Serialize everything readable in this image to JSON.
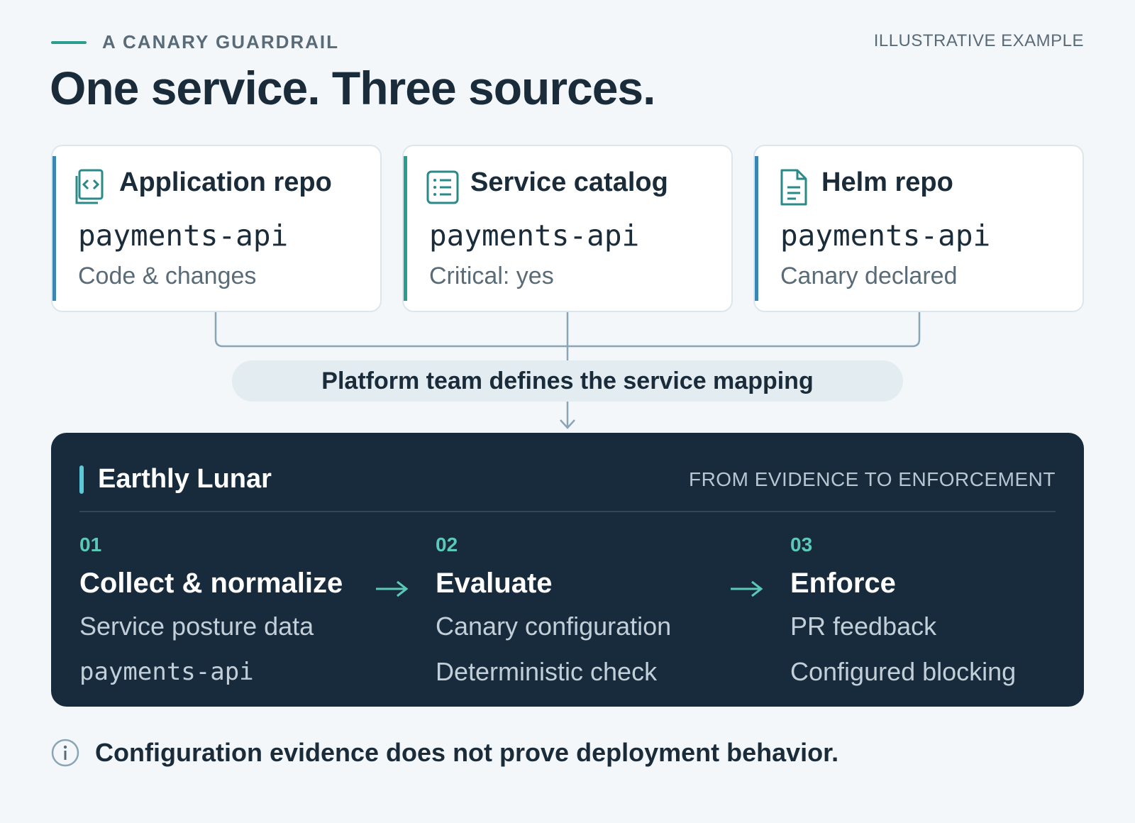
{
  "header": {
    "eyebrow": "A CANARY GUARDRAIL",
    "tag": "ILLUSTRATIVE EXAMPLE",
    "title": "One service. Three sources."
  },
  "sources": [
    {
      "title": "Application repo",
      "service": "payments-api",
      "detail": "Code & changes",
      "icon": "code-files-icon",
      "accent": "#3a87b5"
    },
    {
      "title": "Service catalog",
      "service": "payments-api",
      "detail": "Critical: yes",
      "icon": "list-icon",
      "accent": "#2a9d8f"
    },
    {
      "title": "Helm repo",
      "service": "payments-api",
      "detail": "Canary declared",
      "icon": "document-icon",
      "accent": "#3a87b5"
    }
  ],
  "mapping": {
    "label": "Platform team defines the service mapping"
  },
  "panel": {
    "title": "Earthly Lunar",
    "tag": "FROM EVIDENCE TO ENFORCEMENT",
    "steps": [
      {
        "number": "01",
        "title": "Collect & normalize",
        "line1": "Service posture data",
        "line2": "payments-api"
      },
      {
        "number": "02",
        "title": "Evaluate",
        "line1": "Canary configuration",
        "line2": "Deterministic check"
      },
      {
        "number": "03",
        "title": "Enforce",
        "line1": "PR feedback",
        "line2": "Configured blocking"
      }
    ]
  },
  "note": {
    "text": "Configuration evidence does not prove deployment behavior.",
    "icon": "info-icon"
  },
  "colors": {
    "background": "#f3f7fa",
    "panel": "#172b3c",
    "teal": "#2a9d8f",
    "step_number": "#5cc8b8",
    "connector": "#8aa5b5"
  }
}
